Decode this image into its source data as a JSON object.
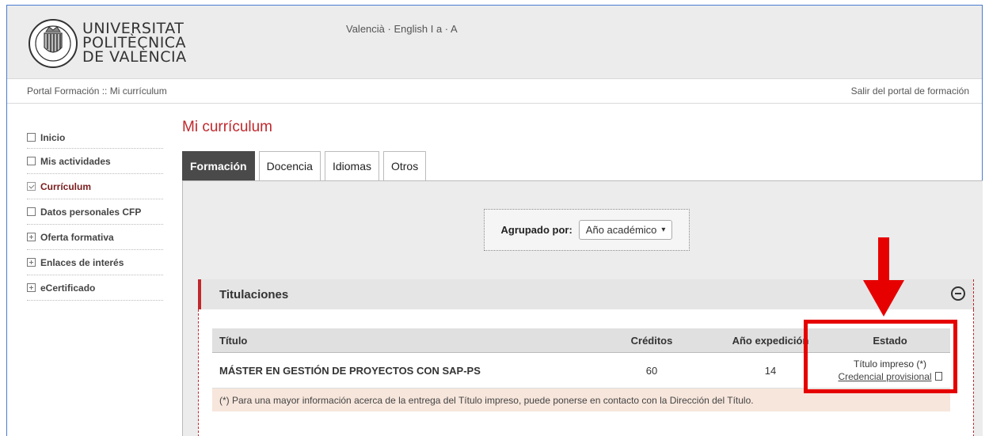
{
  "header": {
    "logo_lines": [
      "UNIVERSITAT",
      "POLITÈCNICA",
      "DE VALÈNCIA"
    ],
    "lang_links": [
      "Valencià",
      "English",
      "a",
      "A"
    ],
    "lang_seps": [
      " · ",
      "  I  ",
      " · "
    ]
  },
  "subbar": {
    "breadcrumb": "Portal Formación  :: Mi currículum",
    "exit_link": "Salir del portal de formación"
  },
  "sidebar": {
    "items": [
      {
        "label": "Inicio",
        "icon": "square-icon"
      },
      {
        "label": "Mis actividades",
        "icon": "square-icon"
      },
      {
        "label": "Currículum",
        "icon": "check-square-icon",
        "active": true
      },
      {
        "label": "Datos personales CFP",
        "icon": "square-icon"
      },
      {
        "label": "Oferta formativa",
        "icon": "plus-square-icon"
      },
      {
        "label": "Enlaces de interés",
        "icon": "plus-square-icon"
      },
      {
        "label": "eCertificado",
        "icon": "plus-square-icon"
      }
    ]
  },
  "main": {
    "title": "Mi currículum",
    "tabs": [
      {
        "label": "Formación",
        "active": true
      },
      {
        "label": "Docencia"
      },
      {
        "label": "Idiomas"
      },
      {
        "label": "Otros"
      }
    ],
    "group": {
      "label": "Agrupado por:",
      "selected": "Año académico"
    },
    "titulaciones": {
      "title": "Titulaciones",
      "columns": [
        "Título",
        "Créditos",
        "Año expedición",
        "Estado"
      ],
      "rows": [
        {
          "titulo": "MÁSTER EN GESTIÓN DE PROYECTOS CON SAP-PS",
          "creditos": "60",
          "anio": "14",
          "estado": "Título impreso (*)",
          "link": "Credencial provisional"
        }
      ],
      "note": "(*) Para una mayor información acerca de la entrega del Título impreso, puede ponerse en contacto con la Dirección del Título."
    }
  },
  "colors": {
    "accent_red": "#c0282d",
    "highlight_red": "#e60000",
    "tab_active_bg": "#4a4a4a"
  }
}
